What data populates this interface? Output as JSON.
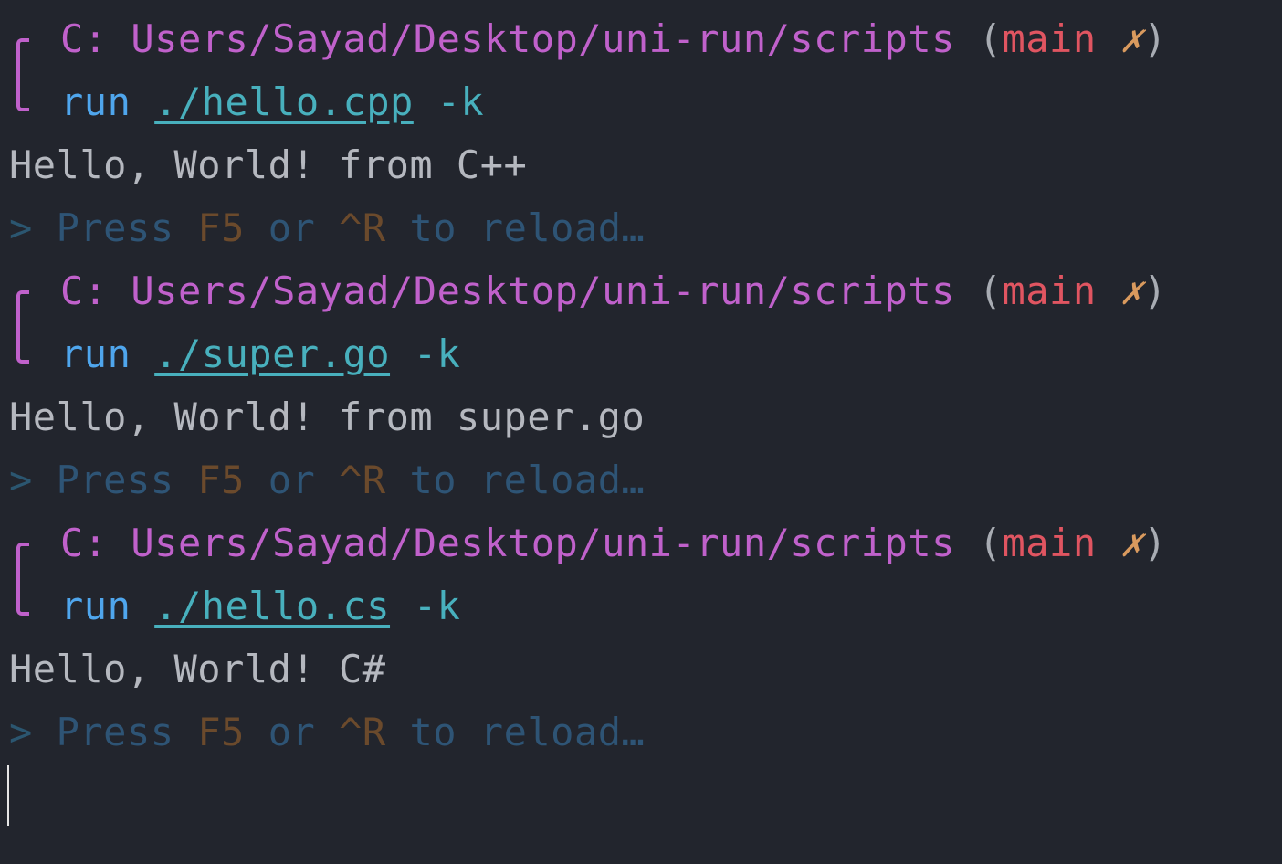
{
  "terminal": {
    "blocks": [
      {
        "prompt": {
          "drive": "C:",
          "path": "Users/Sayad/Desktop/uni-run/scripts",
          "paren_open": "(",
          "branch": "main",
          "dirty_mark": "✗",
          "paren_close": ")"
        },
        "command": {
          "cmd": "run",
          "file": "./hello.cpp",
          "flag": "-k"
        },
        "output": "Hello, World! from C++",
        "hint": {
          "gt": ">",
          "press": "Press",
          "key1": "F5",
          "or": "or",
          "key2": "^R",
          "rest": "to reload…"
        }
      },
      {
        "prompt": {
          "drive": "C:",
          "path": "Users/Sayad/Desktop/uni-run/scripts",
          "paren_open": "(",
          "branch": "main",
          "dirty_mark": "✗",
          "paren_close": ")"
        },
        "command": {
          "cmd": "run",
          "file": "./super.go",
          "flag": "-k"
        },
        "output": "Hello, World! from super.go",
        "hint": {
          "gt": ">",
          "press": "Press",
          "key1": "F5",
          "or": "or",
          "key2": "^R",
          "rest": "to reload…"
        }
      },
      {
        "prompt": {
          "drive": "C:",
          "path": "Users/Sayad/Desktop/uni-run/scripts",
          "paren_open": "(",
          "branch": "main",
          "dirty_mark": "✗",
          "paren_close": ")"
        },
        "command": {
          "cmd": "run",
          "file": "./hello.cs",
          "flag": "-k"
        },
        "output": "Hello, World! C#",
        "hint": {
          "gt": ">",
          "press": "Press",
          "key1": "F5",
          "or": "or",
          "key2": "^R",
          "rest": "to reload…"
        }
      }
    ],
    "colors": {
      "background": "#22252d",
      "path": "#c061cb",
      "branch": "#e05561",
      "dirty": "#d99a5e",
      "command": "#4fa6ed",
      "file": "#48b0bd",
      "output": "#b5b8bf"
    }
  }
}
